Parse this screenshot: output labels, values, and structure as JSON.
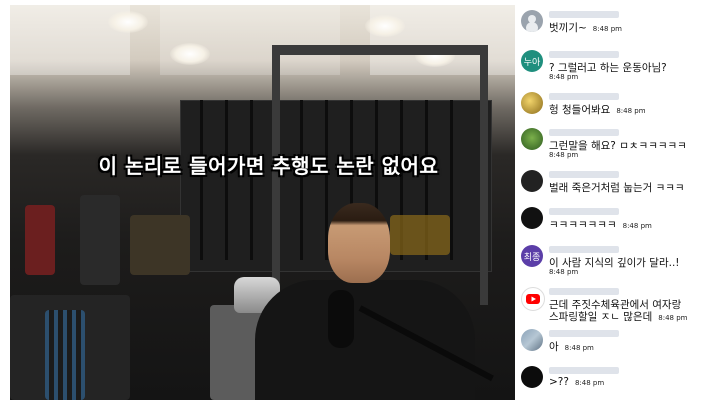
{
  "caption": "이 논리로 들어가면 추행도 논란 없어요",
  "chat": {
    "messages": [
      {
        "avatar": "person-placeholder-icon",
        "avatar_text": "",
        "text": "벗끼기~",
        "time": "8:48 pm"
      },
      {
        "avatar": "initials-avatar",
        "avatar_text": "누아",
        "text": "? 그럴러고 하는 운동아님?",
        "time": "8:48 pm"
      },
      {
        "avatar": "image-avatar",
        "avatar_text": "",
        "text": "헝 청들어봐요",
        "time": "8:48 pm"
      },
      {
        "avatar": "image-avatar",
        "avatar_text": "",
        "text": "그런말을 해요? ㅁㅊㅋㅋㅋㅋㅋ",
        "time": "8:48 pm"
      },
      {
        "avatar": "image-avatar",
        "avatar_text": "",
        "text": "벌래 죽은거처럼 눕는거 ㅋㅋㅋ",
        "time": ""
      },
      {
        "avatar": "image-avatar",
        "avatar_text": "",
        "text": "ㅋㅋㅋㅋㅋㅋㅋ",
        "time": "8:48 pm"
      },
      {
        "avatar": "initials-avatar",
        "avatar_text": "최종",
        "text": "이 사람 지식의 깊이가 달라..!",
        "time": "8:48 pm"
      },
      {
        "avatar": "youtube-icon",
        "avatar_text": "",
        "text": "근데 주짓수체육관에서 여자랑",
        "text2": "스파링할일 ㅈㄴ 많은데",
        "time": "8:48 pm"
      },
      {
        "avatar": "image-avatar",
        "avatar_text": "",
        "text": "아",
        "time": "8:48 pm"
      },
      {
        "avatar": "image-avatar",
        "avatar_text": "",
        "text": ">??",
        "time": "8:48 pm"
      }
    ]
  },
  "colors": {
    "caption_fill": "#ffffff",
    "caption_outline": "#000000",
    "chat_bg": "#ffffff",
    "youtube_red": "#ff0000"
  }
}
